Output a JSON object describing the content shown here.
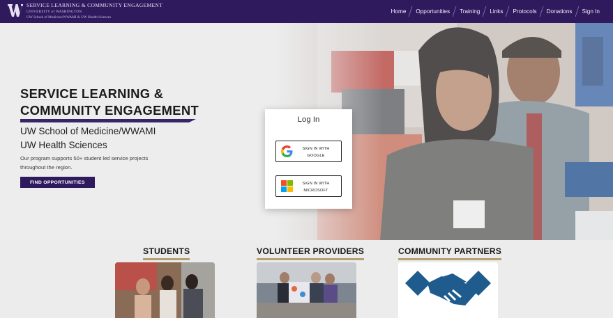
{
  "header": {
    "brand_line1": "SERVICE LEARNING & COMMUNITY ENGAGEMENT",
    "brand_line2": "UNIVERSITY of WASHINGTON",
    "brand_line3": "UW School of Medicine/WWAMI & UW Health Sciences",
    "logo_icon": "uw-w-logo",
    "nav": [
      "Home",
      "Opportunities",
      "Training",
      "Links",
      "Protocols",
      "Donations",
      "Sign In"
    ]
  },
  "hero": {
    "title_line1": "SERVICE LEARNING &",
    "title_line2": "COMMUNITY ENGAGEMENT",
    "subtitle_line1": "UW School of Medicine/WWAMI",
    "subtitle_line2": "UW Health Sciences",
    "description": "Our program supports 50+ student led service projects throughout the region.",
    "button_label": "FIND OPPORTUNITIES"
  },
  "login": {
    "title": "Log In",
    "google_line1": "SIGN IN WITH",
    "google_line2": "GOOGLE",
    "microsoft_line1": "SIGN IN WITH",
    "microsoft_line2": "MICROSOFT"
  },
  "sections": [
    {
      "title": "STUDENTS"
    },
    {
      "title": "VOLUNTEER PROVIDERS"
    },
    {
      "title": "COMMUNITY PARTNERS"
    }
  ],
  "colors": {
    "brand_purple": "#2f1a5e",
    "gold": "#b59f73",
    "handshake_blue": "#1f5b8d"
  }
}
